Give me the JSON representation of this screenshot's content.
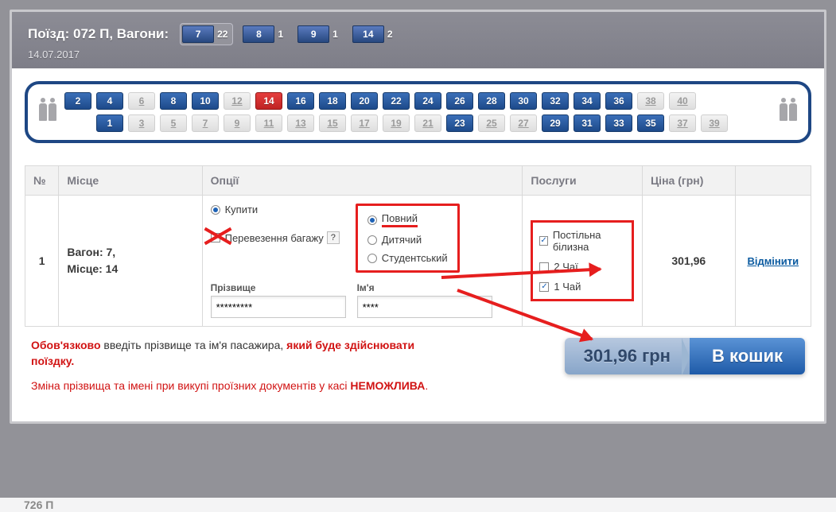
{
  "header": {
    "train_label": "Поїзд: 072 П, Вагони:",
    "date": "14.07.2017",
    "wagons": [
      {
        "num": "7",
        "count": "22",
        "active": true
      },
      {
        "num": "8",
        "count": "1",
        "active": false
      },
      {
        "num": "9",
        "count": "1",
        "active": false
      },
      {
        "num": "14",
        "count": "2",
        "active": false
      }
    ]
  },
  "seat_map": {
    "top_row": [
      {
        "n": "2",
        "state": "available"
      },
      {
        "n": "4",
        "state": "available"
      },
      {
        "n": "6",
        "state": "disabled"
      },
      {
        "n": "8",
        "state": "available"
      },
      {
        "n": "10",
        "state": "available"
      },
      {
        "n": "12",
        "state": "disabled"
      },
      {
        "n": "14",
        "state": "selected"
      },
      {
        "n": "16",
        "state": "available"
      },
      {
        "n": "18",
        "state": "available"
      },
      {
        "n": "20",
        "state": "available"
      },
      {
        "n": "22",
        "state": "available"
      },
      {
        "n": "24",
        "state": "available"
      },
      {
        "n": "26",
        "state": "available"
      },
      {
        "n": "28",
        "state": "available"
      },
      {
        "n": "30",
        "state": "available"
      },
      {
        "n": "32",
        "state": "available"
      },
      {
        "n": "34",
        "state": "available"
      },
      {
        "n": "36",
        "state": "available"
      },
      {
        "n": "38",
        "state": "disabled"
      },
      {
        "n": "40",
        "state": "disabled"
      }
    ],
    "bottom_row": [
      {
        "n": "",
        "state": "placeholder"
      },
      {
        "n": "1",
        "state": "available"
      },
      {
        "n": "3",
        "state": "disabled"
      },
      {
        "n": "5",
        "state": "disabled"
      },
      {
        "n": "7",
        "state": "disabled"
      },
      {
        "n": "9",
        "state": "disabled"
      },
      {
        "n": "11",
        "state": "disabled"
      },
      {
        "n": "13",
        "state": "disabled"
      },
      {
        "n": "15",
        "state": "disabled"
      },
      {
        "n": "17",
        "state": "disabled"
      },
      {
        "n": "19",
        "state": "disabled"
      },
      {
        "n": "21",
        "state": "disabled"
      },
      {
        "n": "23",
        "state": "available"
      },
      {
        "n": "25",
        "state": "disabled"
      },
      {
        "n": "27",
        "state": "disabled"
      },
      {
        "n": "29",
        "state": "available"
      },
      {
        "n": "31",
        "state": "available"
      },
      {
        "n": "33",
        "state": "available"
      },
      {
        "n": "35",
        "state": "available"
      },
      {
        "n": "37",
        "state": "disabled"
      },
      {
        "n": "39",
        "state": "disabled"
      }
    ]
  },
  "table": {
    "headers": {
      "num": "№",
      "place": "Місце",
      "options": "Опції",
      "services": "Послуги",
      "price": "Ціна (грн)"
    },
    "row": {
      "num": "1",
      "wagon_label": "Вагон: 7,",
      "seat_label": "Місце: 14",
      "opts": {
        "buy": "Купити",
        "baggage": "Перевезення багажу",
        "help": "?",
        "types": {
          "full": "Повний",
          "child": "Дитячий",
          "student": "Студентський"
        },
        "lastname_label": "Прізвище",
        "firstname_label": "Ім'я",
        "lastname_value": "*********",
        "firstname_value": "****"
      },
      "services": {
        "linen": "Постільна білизна",
        "tea2": "2 Чаї",
        "tea1": "1 Чай"
      },
      "price": "301,96",
      "cancel": "Відмінити"
    }
  },
  "footer": {
    "warn1_a": "Обов'язково",
    "warn1_b": " введіть прізвище та ім'я пасажира, ",
    "warn1_c": "який буде здійснювати поїздку",
    "warn1_d": ".",
    "warn2_a": "Зміна прізвища та імені при викупі проїзних документів у касі ",
    "warn2_b": "НЕМОЖЛИВА",
    "warn2_c": ".",
    "cart_price": "301,96 грн",
    "cart_label": "В кошик"
  },
  "bg_hint": "726 П"
}
